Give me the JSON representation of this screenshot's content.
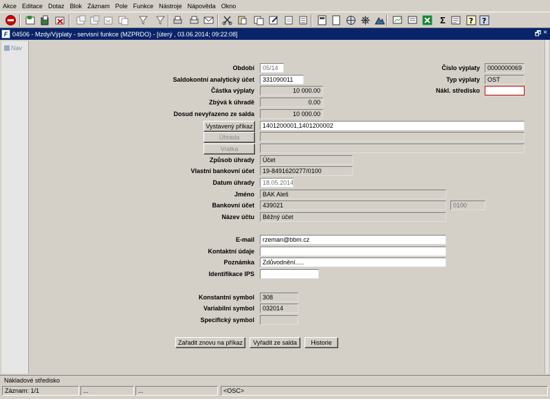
{
  "menu": [
    "Akce",
    "Editace",
    "Dotaz",
    "Blok",
    "Záznam",
    "Pole",
    "Funkce",
    "Nástroje",
    "Nápověda",
    "Okno"
  ],
  "window": {
    "app_icon_text": "F",
    "title": "04506 - Mzdy/Výplaty - servisní funkce (MZPRDO) - [úterý  , 03.06.2014; 09:22:08]",
    "ctl_restore": "🗗",
    "ctl_close": "×"
  },
  "nav": {
    "label": "Nav"
  },
  "form": {
    "obdobi": {
      "label": "Období",
      "value": "05/14"
    },
    "saldo_ucet": {
      "label": "Saldokontní analytický účet",
      "value": "331090011"
    },
    "castka": {
      "label": "Částka výplaty",
      "value": "10 000.00"
    },
    "zbyva": {
      "label": "Zbývá k úhradě",
      "value": "0.00"
    },
    "dosud": {
      "label": "Dosud nevyřazeno ze salda",
      "value": "10 000.00"
    },
    "cislo_vyplaty": {
      "label": "Číslo výplaty",
      "value": "0000000069"
    },
    "typ_vyplaty": {
      "label": "Typ výplaty",
      "value": "OST"
    },
    "nakl_stredisko": {
      "label": "Nákl. středisko",
      "value": ""
    },
    "vystaveny_prikaz": {
      "button": "Vystavený příkaz",
      "value": "1401200001,1401200002"
    },
    "uhrada": {
      "button": "Úhrada",
      "value": ""
    },
    "vratka": {
      "button": "Vratka",
      "value": ""
    },
    "zpusob_uhrady": {
      "label": "Způsob úhrady",
      "value": "Účet"
    },
    "vlastni_ucet": {
      "label": "Vlastní bankovní účet",
      "value": "19-8491620277/0100"
    },
    "datum_uhrady": {
      "label": "Datum úhrady",
      "value": "18.05.2014"
    },
    "jmeno": {
      "label": "Jméno",
      "value": "BAK Aleš"
    },
    "bankovni_ucet": {
      "label": "Bankovní účet",
      "value": "439021",
      "bank_code": "0100"
    },
    "nazev_uctu": {
      "label": "Název účtu",
      "value": "Běžný účet"
    },
    "email": {
      "label": "E-mail",
      "value": "rzeman@bbm.cz"
    },
    "kontaktni_udaje": {
      "label": "Kontaktní údaje",
      "value": ""
    },
    "poznamka": {
      "label": "Poznámka",
      "value": "Zdůvodnění....."
    },
    "identifikace_ips": {
      "label": "Identifikace IPS",
      "value": ""
    },
    "konst_symbol": {
      "label": "Konstantní symbol",
      "value": "308"
    },
    "var_symbol": {
      "label": "Variabilní symbol",
      "value": "032014"
    },
    "spec_symbol": {
      "label": "Specifický symbol",
      "value": ""
    }
  },
  "buttons": {
    "zaradit": "Zařadit znovu na příkaz",
    "vyradit": "Vyřadit ze salda",
    "historie": "Historie"
  },
  "status": {
    "hint": "Nákladové středisko",
    "record": "Záznam: 1/1",
    "cell2": "...",
    "cell3": "...",
    "mode": "<OSC>"
  }
}
